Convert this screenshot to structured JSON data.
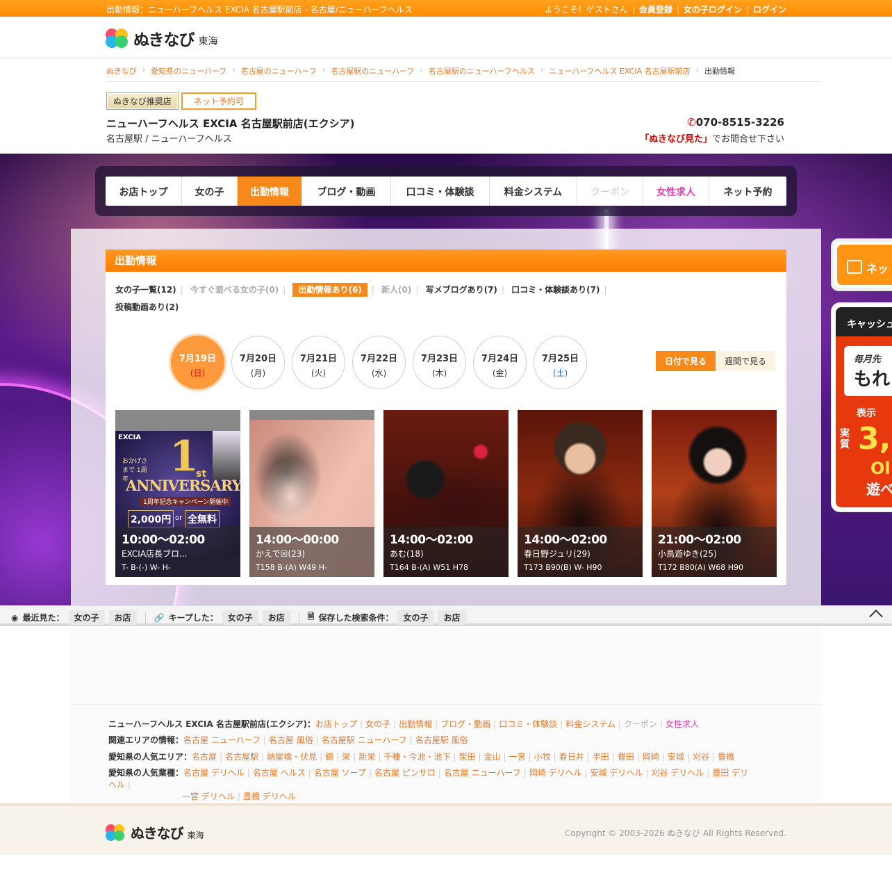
{
  "topbar": {
    "left_text": "出勤情報：ニューハーフヘルス EXCIA 名古屋駅前店 - 名古屋/ニューハーフヘルス",
    "welcome": "ようこそ！ゲストさん",
    "register": "会員登録",
    "girl_login": "女の子ログイン",
    "login": "ログイン"
  },
  "logo": {
    "text": "ぬきなび",
    "area": "東海"
  },
  "breadcrumb": [
    "ぬきなび",
    "愛知県のニューハーフ",
    "名古屋のニューハーフ",
    "名古屋駅のニューハーフ",
    "名古屋駅のニューハーフヘルス",
    "ニューハーフヘルス EXCIA 名古屋駅前店",
    "出勤情報"
  ],
  "shop": {
    "badge_recommended": "ぬきなび推奨店",
    "badge_reserve": "ネット予約可",
    "name": "ニューハーフヘルス EXCIA 名古屋駅前店(エクシア)",
    "sub": "名古屋駅 / ニューハーフヘルス",
    "tel": "070-8515-3226",
    "tel_note_red": "「ぬきなび見た」",
    "tel_note": "でお問合せ下さい"
  },
  "nav": [
    "お店トップ",
    "女の子",
    "出勤情報",
    "ブログ・動画",
    "口コミ・体験談",
    "料金システム",
    "クーポン",
    "女性求人",
    "ネット予約"
  ],
  "panel": {
    "title": "出勤情報",
    "filters": [
      "女の子一覧(12)",
      "今すぐ遊べる女の子(0)",
      "出勤情報あり(6)",
      "新人(0)",
      "写メブログあり(7)",
      "口コミ・体験談あり(7)",
      "投稿動画あり(2)"
    ],
    "days": [
      {
        "d": "7月19日",
        "w": "(日)"
      },
      {
        "d": "7月20日",
        "w": "(月)"
      },
      {
        "d": "7月21日",
        "w": "(火)"
      },
      {
        "d": "7月22日",
        "w": "(水)"
      },
      {
        "d": "7月23日",
        "w": "(木)"
      },
      {
        "d": "7月24日",
        "w": "(金)"
      },
      {
        "d": "7月25日",
        "w": "(土)"
      }
    ],
    "view_date": "日付で見る",
    "view_week": "週間で見る",
    "cards": [
      {
        "time": "10:00〜02:00",
        "name": "EXCIA店長ブロ...",
        "size": "T- B-(-) W- H-"
      },
      {
        "time": "14:00〜00:00",
        "name": "かえで☒(23)",
        "size": "T158 B-(A) W49 H-"
      },
      {
        "time": "14:00〜02:00",
        "name": "あむ(18)",
        "size": "T164 B-(A) W51 H78"
      },
      {
        "time": "14:00〜02:00",
        "name": "春日野ジュリ(29)",
        "size": "T173 B90(B) W- H90"
      },
      {
        "time": "21:00〜02:00",
        "name": "小鳥遊ゆき(25)",
        "size": "T172 B80(A) W68 H90"
      }
    ],
    "card1_art": {
      "brand": "EXCIA",
      "anniv": "ANNIVERSARY",
      "num": "1",
      "st": "st",
      "sub": "おかげさまで 1周年",
      "camp": "1周年記念キャンペーン開催中",
      "price": "2,000円",
      "or": "or",
      "free": "全無料"
    }
  },
  "side": {
    "reserve": "ネッ",
    "cash": "キャッシュ",
    "month": "毎月先",
    "big": "もれ",
    "disp": "表示",
    "real": "実質",
    "amount": "3,0",
    "ol": "Ol",
    "play": "遊べ"
  },
  "bottombar": {
    "recent": "最近見た：",
    "girl": "女の子",
    "shop": "お店",
    "kept": "キープした：",
    "saved": "保存した検索条件："
  },
  "links": {
    "row1_label": "ニューハーフヘルス EXCIA 名古屋駅前店(エクシア)：",
    "row1": [
      "お店トップ",
      "女の子",
      "出勤情報",
      "ブログ・動画",
      "口コミ・体験談",
      "料金システム",
      "クーポン",
      "女性求人"
    ],
    "row2_label": "関連エリアの情報：",
    "row2": [
      "名古屋 ニューハーフ",
      "名古屋 風俗",
      "名古屋駅 ニューハーフ",
      "名古屋駅 風俗"
    ],
    "row3_label": "愛知県の人気エリア：",
    "row3": [
      "名古屋",
      "名古屋駅",
      "納屋橋・伏見",
      "錦",
      "栄",
      "新栄",
      "千種・今池・池下",
      "柴田",
      "金山",
      "一宮",
      "小牧",
      "春日井",
      "半田",
      "豊田",
      "岡崎",
      "安城",
      "刈谷",
      "豊橋"
    ],
    "row4_label": "愛知県の人気業種：",
    "row4": [
      "名古屋 デリヘル",
      "名古屋 ヘルス",
      "名古屋 ソープ",
      "名古屋 ピンサロ",
      "名古屋 ニューハーフ",
      "岡崎 デリヘル",
      "安城 デリヘル",
      "刈谷 デリヘル",
      "豊田 デリヘル",
      "一宮 デリヘル",
      "豊橋 デリヘル"
    ]
  },
  "footer": {
    "copyright": "Copyright © 2003-2026 ぬきなび All Rights Reserved."
  }
}
